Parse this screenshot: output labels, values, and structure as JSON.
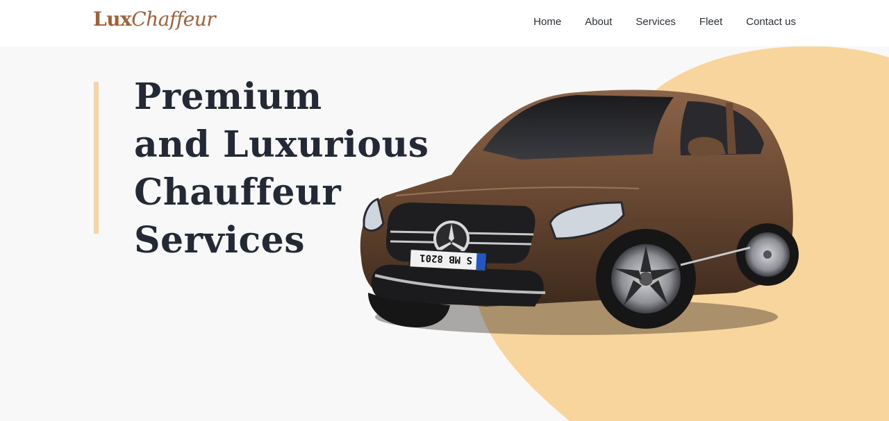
{
  "brand": {
    "bold": "Lux",
    "light": "Chaffeur"
  },
  "nav": {
    "home": "Home",
    "about": "About",
    "services": "Services",
    "fleet": "Fleet",
    "contact": "Contact us"
  },
  "hero": {
    "headline_lines": [
      "Premium",
      "and Luxurious",
      "Chauffeur",
      "Services"
    ]
  },
  "car": {
    "plate": "S MB 8201"
  },
  "colors": {
    "brand": "#a0603a",
    "accent": "#f7d59c",
    "heading": "#232a36",
    "car_body": "#6b4a33"
  }
}
